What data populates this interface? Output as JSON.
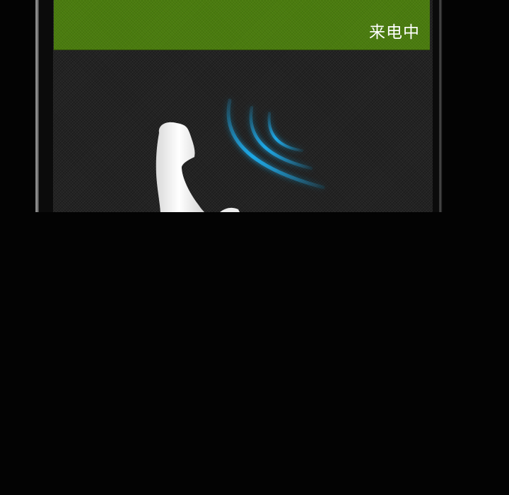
{
  "call": {
    "status_text": "来电中"
  },
  "icons": {
    "handset": "phone-handset-icon",
    "waves": "signal-waves-icon"
  },
  "colors": {
    "header_green": "#4a7c0e",
    "screen_dark": "#232323",
    "wave_blue": "#1ea8e6",
    "handset_white": "#f4f4f4"
  }
}
